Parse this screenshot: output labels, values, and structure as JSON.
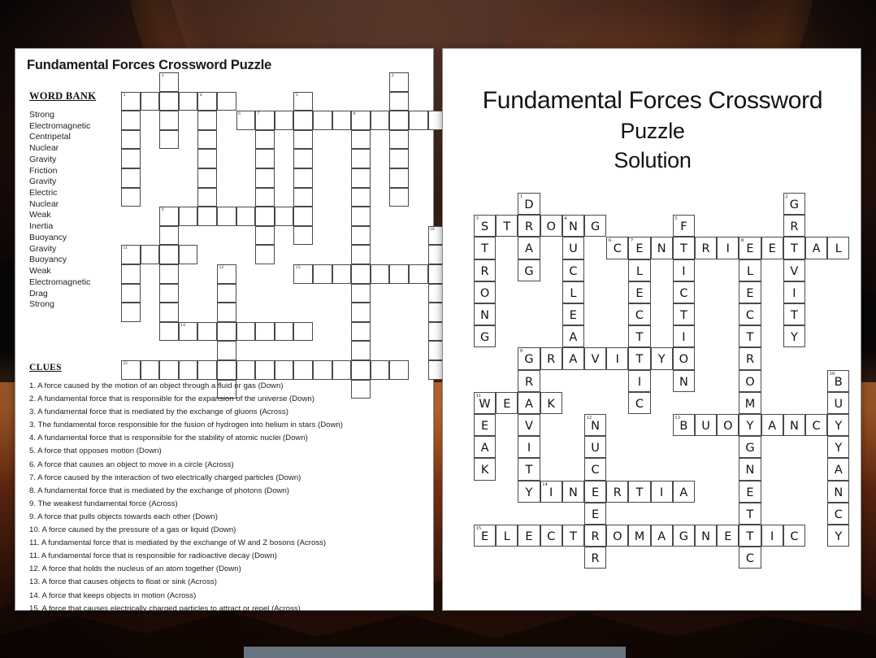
{
  "puzzle": {
    "title": "Fundamental Forces Crossword Puzzle",
    "word_bank_heading": "WORD BANK",
    "word_bank": [
      "Strong",
      "Electromagnetic",
      "Centripetal",
      "Nuclear",
      "Gravity",
      "Friction",
      "Gravity",
      "Electric",
      "Nuclear",
      "Weak",
      "Inertia",
      "Buoyancy",
      "Gravity",
      "Buoyancy",
      "Weak",
      "Electromagnetic",
      "Drag",
      "Strong"
    ],
    "clues_heading": "CLUES",
    "clues": [
      "1. A force caused by the motion of an object through a fluid or gas (Down)",
      "2. A fundamental force that is responsible for the expansion of the universe (Down)",
      "3. A fundamental force that is mediated by the exchange of gluons (Across)",
      "3. The fundamental force responsible for the fusion of hydrogen into helium in stars (Down)",
      "4. A fundamental force that is responsible for the stability of atomic nuclei (Down)",
      "5. A force that opposes motion (Down)",
      "6. A force that causes an object to move in a circle (Across)",
      "7. A force caused by the interaction of two electrically charged particles (Down)",
      "8. A fundamental force that is mediated by the exchange of photons (Down)",
      "9. The weakest fundamental force (Across)",
      "9. A force that pulls objects towards each other (Down)",
      "10. A force caused by the pressure of a gas or liquid (Down)",
      "11. A fundamental force that is mediated by the exchange of W and Z bosons (Across)",
      "11. A fundamental force that is responsible for radioactive decay (Down)",
      "12. A force that holds the nucleus of an atom together (Down)",
      "13. A force that causes objects to float or sink (Across)",
      "14. A force that keeps objects in motion (Across)",
      "15. A force that causes electrically charged particles to attract or repel (Across)"
    ]
  },
  "solution": {
    "title_line1": "Fundamental Forces Crossword",
    "title_line2": "Puzzle",
    "title_line3": "Solution"
  },
  "crossword": {
    "columns": 17,
    "rows": 16,
    "answers": [
      {
        "number": 1,
        "clue_number": "1",
        "word": "DRAG",
        "direction": "down",
        "row": 0,
        "col": 2
      },
      {
        "number": 2,
        "clue_number": "2",
        "word": "GRAVITY",
        "direction": "down",
        "row": 0,
        "col": 14
      },
      {
        "number": 3,
        "clue_number": "3",
        "word": "STRONG",
        "direction": "across",
        "row": 1,
        "col": 0
      },
      {
        "number": 4,
        "clue_number": "3",
        "word": "STRONG",
        "direction": "down",
        "row": 1,
        "col": 0
      },
      {
        "number": 5,
        "clue_number": "4",
        "word": "NUCLEAR",
        "direction": "down",
        "row": 1,
        "col": 4
      },
      {
        "number": 6,
        "clue_number": "5",
        "word": "FRICTION",
        "direction": "down",
        "row": 1,
        "col": 9
      },
      {
        "number": 7,
        "clue_number": "6",
        "word": "CENTRIPETAL",
        "direction": "across",
        "row": 2,
        "col": 6
      },
      {
        "number": 8,
        "clue_number": "7",
        "word": "ELECTRIC",
        "direction": "down",
        "row": 2,
        "col": 7
      },
      {
        "number": 9,
        "clue_number": "8",
        "word": "ELECTROMAGNETIC",
        "direction": "down",
        "row": 2,
        "col": 12
      },
      {
        "number": 10,
        "clue_number": "9",
        "word": "GRAVITY",
        "direction": "across",
        "row": 7,
        "col": 2
      },
      {
        "number": 11,
        "clue_number": "9",
        "word": "GRAVITY",
        "direction": "down",
        "row": 7,
        "col": 2
      },
      {
        "number": 12,
        "clue_number": "10",
        "word": "BUOYANCY",
        "direction": "down",
        "row": 8,
        "col": 16
      },
      {
        "number": 13,
        "clue_number": "11",
        "word": "WEAK",
        "direction": "across",
        "row": 9,
        "col": 0
      },
      {
        "number": 14,
        "clue_number": "11",
        "word": "WEAK",
        "direction": "down",
        "row": 9,
        "col": 0
      },
      {
        "number": 15,
        "clue_number": "12",
        "word": "NUCLEAR",
        "direction": "down",
        "row": 10,
        "col": 5
      },
      {
        "number": 16,
        "clue_number": "13",
        "word": "BUOYANCY",
        "direction": "across",
        "row": 10,
        "col": 9
      },
      {
        "number": 17,
        "clue_number": "14",
        "word": "INERTIA",
        "direction": "across",
        "row": 13,
        "col": 3
      },
      {
        "number": 18,
        "clue_number": "15",
        "word": "ELECTROMAGNETIC",
        "direction": "across",
        "row": 15,
        "col": 0
      }
    ]
  }
}
